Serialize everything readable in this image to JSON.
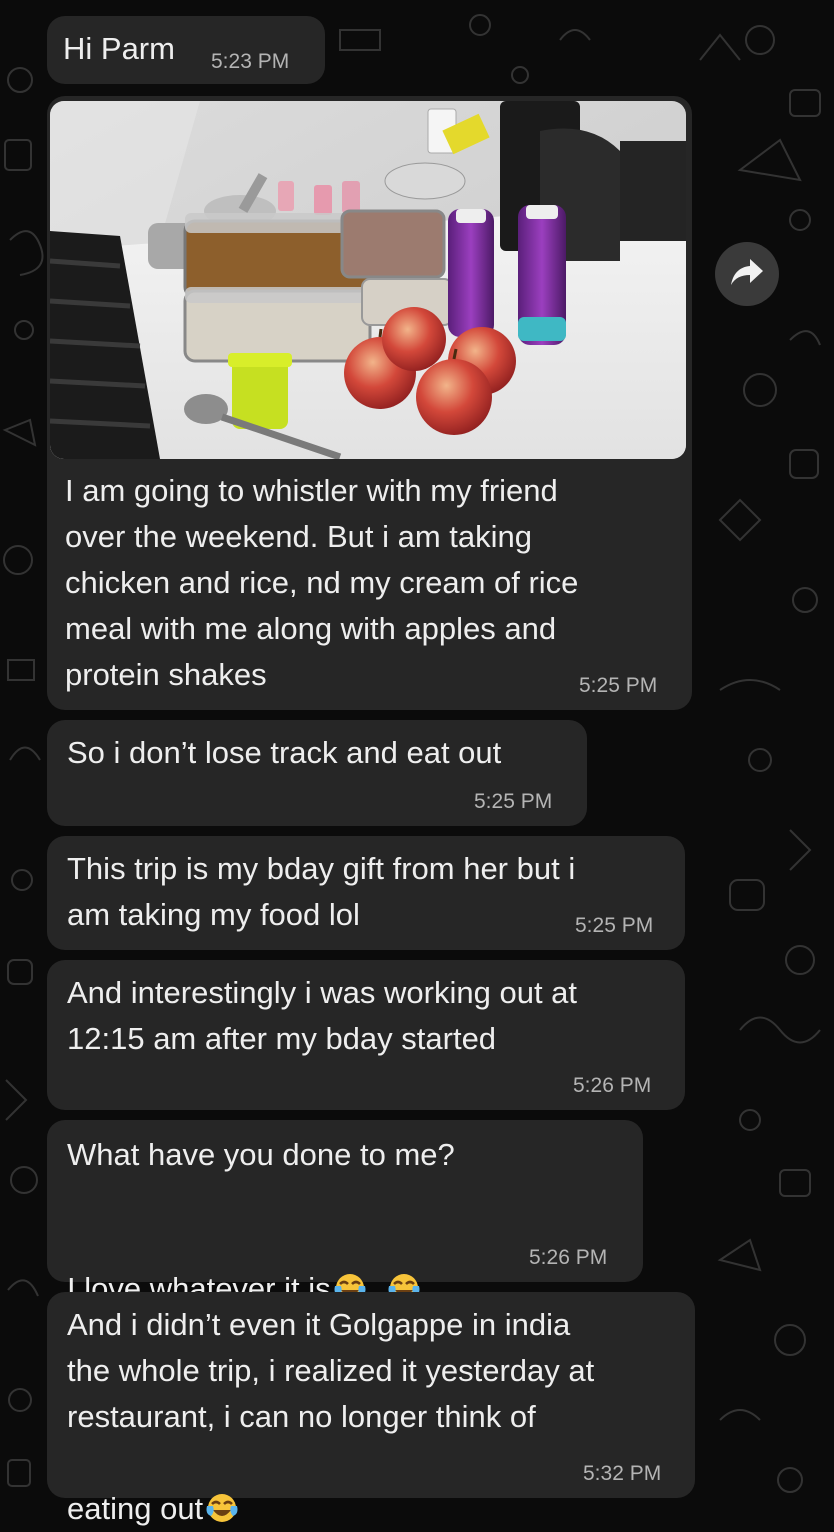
{
  "messages": [
    {
      "text": "Hi Parm",
      "time": "5:23 PM"
    },
    {
      "text": "I am going to whistler with my friend\nover the weekend. But i am taking\nchicken and rice, nd my cream of rice\nmeal with me along with apples and\nprotein shakes",
      "time": "5:25 PM",
      "image": "food-prep-photo"
    },
    {
      "text": "So i don’t lose track and eat out",
      "time": "5:25 PM"
    },
    {
      "text": "This trip is my bday gift from her but i\nam taking my food lol",
      "time": "5:25 PM"
    },
    {
      "text": "And interestingly i was working out at\n12:15 am after my bday started",
      "time": "5:26 PM"
    },
    {
      "text_line1": "What have you done to me?",
      "text_line2": "I love whatever it is",
      "time": "5:26 PM",
      "emojis": [
        "tears-of-joy",
        "tears-of-joy"
      ]
    },
    {
      "text_lines": "And i didn’t even it Golgappe in india\nthe whole trip, i realized it yesterday at\nrestaurant, i can no longer think of",
      "text_last": "eating out",
      "time": "5:32 PM",
      "emojis": [
        "tears-of-joy"
      ]
    }
  ],
  "icons": {
    "forward": "forward-arrow-icon",
    "emoji": "tears-of-joy-emoji"
  },
  "colors": {
    "background": "#0b0b0b",
    "bubble": "#262626",
    "text": "#eeeeee",
    "timestamp": "#b4b4b4"
  }
}
